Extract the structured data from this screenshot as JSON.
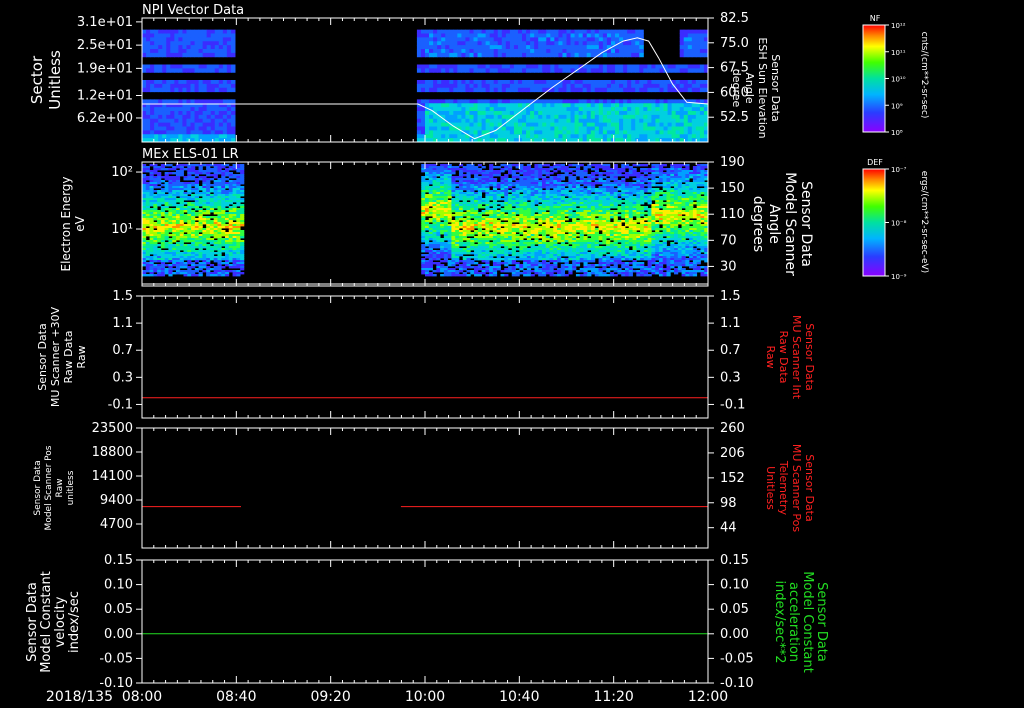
{
  "time_axis": {
    "date_label": "2018/135",
    "tick_labels": [
      "08:00",
      "08:40",
      "09:20",
      "10:00",
      "10:40",
      "11:20",
      "12:00"
    ],
    "start_hours": 8.0,
    "end_hours": 12.0
  },
  "colors": {
    "frame": "#ffffff",
    "red_trace": "#ff2020",
    "green_trace": "#22dd22",
    "white_trace": "#ffffff",
    "red_label": "#ff2020",
    "green_label": "#22dd22"
  },
  "panels": {
    "p1": {
      "title": "NPI Vector Data",
      "left_label_1": "Sector",
      "left_label_2": "Unitless",
      "right_label_1": "Sensor Data",
      "right_label_2": "ESH Sun Elevation",
      "right_label_3": "Angle",
      "right_label_4": "degree",
      "colorbar_title": "NF",
      "colorbar_unit": "cnts/(cm**2-sr-sec)",
      "colorbar_ticks": [
        "10⁸",
        "10⁹",
        "10¹⁰",
        "10¹¹",
        "10¹²"
      ]
    },
    "p2": {
      "title": "MEx ELS-01 LR",
      "left_label_1": "Electron Energy",
      "left_label_2": "eV",
      "right_label_1": "Sensor Data",
      "right_label_2": "Model Scanner",
      "right_label_3": "Angle",
      "right_label_4": "degrees",
      "colorbar_title": "DEF",
      "colorbar_unit": "ergs/(cm**2-sr-sec-eV)",
      "colorbar_ticks": [
        "10⁻⁹",
        "10⁻⁸",
        "10⁻⁷"
      ]
    },
    "p3": {
      "left_label_1": "Sensor Data",
      "left_label_2": "MU Scanner +30V",
      "left_label_3": "Raw Data",
      "left_label_4": "Raw",
      "right_label_1": "Sensor Data",
      "right_label_2": "MU Scanner Int",
      "right_label_3": "Raw Data",
      "right_label_4": "Raw"
    },
    "p4": {
      "left_label_1": "Sensor Data",
      "left_label_2": "Model Scanner Pos",
      "left_label_3": "Raw",
      "left_label_4": "unitless",
      "right_label_1": "Sensor Data",
      "right_label_2": "MU Scanner Pos",
      "right_label_3": "Telemetry",
      "right_label_4": "Unitless"
    },
    "p5": {
      "left_label_1": "Sensor Data",
      "left_label_2": "Model Constant",
      "left_label_3": "velocity",
      "left_label_4": "index/sec",
      "right_label_1": "Sensor Data",
      "right_label_2": "Model Constant",
      "right_label_3": "acceleration",
      "right_label_4": "index/sec**2"
    }
  },
  "chart_data": [
    {
      "id": "p1",
      "type": "heatmap",
      "title": "NPI Vector Data",
      "ylabel": "Sector Unitless",
      "y_tick_labels": [
        "3.1e+01",
        "2.5e+01",
        "1.9e+01",
        "1.2e+01",
        "6.2e+00"
      ],
      "y_tick_values": [
        31,
        25,
        19,
        12,
        6.2
      ],
      "ylim": [
        0,
        32
      ],
      "right_axis": {
        "label": "Sensor Data ESH Sun Elevation Angle degree",
        "tick_labels": [
          "82.5",
          "75.0",
          "67.5",
          "60.0",
          "52.5"
        ],
        "tick_values": [
          82.5,
          75.0,
          67.5,
          60.0,
          52.5
        ],
        "ylim": [
          45.0,
          82.5
        ]
      },
      "data_gaps_hours": [
        [
          8.65,
          9.95
        ]
      ],
      "colorbar": {
        "title": "NF",
        "scale": "log",
        "range": [
          100000000.0,
          1000000000000.0
        ],
        "unit": "cnts/(cm**2-sr-sec)"
      },
      "line_series": {
        "name": "ESH Sun Elevation Angle",
        "axis": "right",
        "x_hours": [
          8.0,
          8.65,
          9.95,
          10.05,
          10.2,
          10.35,
          10.5,
          10.7,
          10.9,
          11.1,
          11.25,
          11.4,
          11.5,
          11.58,
          11.65,
          11.75,
          11.85,
          12.0
        ],
        "y": [
          56.5,
          56.5,
          56.5,
          54.5,
          49.8,
          46.0,
          48.5,
          55.0,
          61.5,
          67.5,
          72.0,
          75.5,
          76.5,
          75.5,
          70.5,
          62.5,
          57.0,
          56.5
        ]
      }
    },
    {
      "id": "p2",
      "type": "heatmap",
      "title": "MEx ELS-01 LR",
      "ylabel": "Electron Energy eV",
      "y_scale": "log",
      "y_tick_labels": [
        "10²",
        "10¹"
      ],
      "y_tick_values": [
        100,
        10
      ],
      "ylim": [
        1,
        150
      ],
      "right_axis": {
        "label": "Sensor Data Model Scanner Angle degrees",
        "tick_labels": [
          "190",
          "150",
          "110",
          "70",
          "30"
        ],
        "tick_values": [
          190,
          150,
          110,
          70,
          30
        ],
        "ylim": [
          0,
          190
        ]
      },
      "data_gaps_hours": [
        [
          8.72,
          9.97
        ]
      ],
      "colorbar": {
        "title": "DEF",
        "scale": "log",
        "range": [
          1e-09,
          1e-07
        ],
        "unit": "ergs/(cm**2-sr-sec-eV)"
      },
      "line_series": {
        "name": "Model Scanner Angle",
        "axis": "right",
        "x_hours": [
          8.0,
          12.0
        ],
        "y": [
          3,
          3
        ]
      }
    },
    {
      "id": "p3",
      "type": "line",
      "ylabel": "Sensor Data MU Scanner +30V Raw Data Raw",
      "y_tick_labels": [
        "1.5",
        "1.1",
        "0.7",
        "0.3",
        "-0.1"
      ],
      "y_tick_values": [
        1.5,
        1.1,
        0.7,
        0.3,
        -0.1
      ],
      "ylim": [
        -0.3,
        1.5
      ],
      "right_axis": {
        "label": "Sensor Data MU Scanner Int Raw Data Raw",
        "tick_labels": [
          "1.5",
          "1.1",
          "0.7",
          "0.3",
          "-0.1"
        ],
        "tick_values": [
          1.5,
          1.1,
          0.7,
          0.3,
          -0.1
        ],
        "ylim": [
          -0.3,
          1.5
        ]
      },
      "series": [
        {
          "axis": "left",
          "color": "#ff2020",
          "segments": [
            {
              "x_hours": [
                8.0,
                12.0
              ],
              "y": [
                0.0,
                0.0
              ]
            }
          ]
        }
      ]
    },
    {
      "id": "p4",
      "type": "line",
      "ylabel": "Sensor Data Model Scanner Pos Raw unitless",
      "y_tick_labels": [
        "23500",
        "18800",
        "14100",
        "9400",
        "4700"
      ],
      "y_tick_values": [
        23500,
        18800,
        14100,
        9400,
        4700
      ],
      "ylim": [
        0,
        23500
      ],
      "right_axis": {
        "label": "Sensor Data MU Scanner Pos Telemetry Unitless",
        "tick_labels": [
          "260",
          "206",
          "152",
          "98",
          "44"
        ],
        "tick_values": [
          260,
          206,
          152,
          98,
          44
        ],
        "ylim": [
          0,
          260
        ]
      },
      "series": [
        {
          "axis": "left",
          "color": "#ff2020",
          "segments": [
            {
              "x_hours": [
                8.0,
                8.7
              ],
              "y": [
                8100,
                8100
              ]
            },
            {
              "x_hours": [
                9.83,
                12.0
              ],
              "y": [
                8100,
                8100
              ]
            }
          ]
        }
      ]
    },
    {
      "id": "p5",
      "type": "line",
      "ylabel": "Sensor Data Model Constant velocity index/sec",
      "y_tick_labels": [
        "0.15",
        "0.10",
        "0.05",
        "0.00",
        "-0.05",
        "-0.10"
      ],
      "y_tick_values": [
        0.15,
        0.1,
        0.05,
        0.0,
        -0.05,
        -0.1
      ],
      "ylim": [
        -0.1,
        0.15
      ],
      "right_axis": {
        "label": "Sensor Data Model Constant acceleration index/sec**2",
        "tick_labels": [
          "0.15",
          "0.10",
          "0.05",
          "0.00",
          "-0.05",
          "-0.10"
        ],
        "tick_values": [
          0.15,
          0.1,
          0.05,
          0.0,
          -0.05,
          -0.1
        ],
        "ylim": [
          -0.1,
          0.15
        ]
      },
      "series": [
        {
          "axis": "left",
          "color": "#22dd22",
          "segments": [
            {
              "x_hours": [
                8.0,
                12.0
              ],
              "y": [
                0.0,
                0.0
              ]
            }
          ]
        }
      ]
    }
  ]
}
